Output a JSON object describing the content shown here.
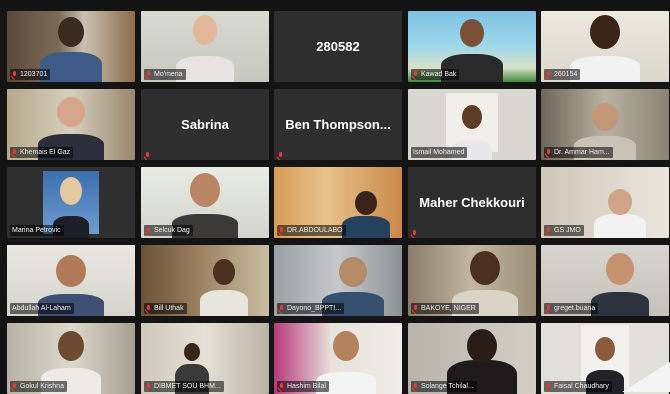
{
  "participants": [
    {
      "label": "1203701"
    },
    {
      "label": "Mo'mena"
    },
    {
      "display_name": "280582"
    },
    {
      "label": "Kawad Bak"
    },
    {
      "label": "260154"
    },
    {
      "label": "Khemais El Gaz"
    },
    {
      "display_name": "Sabrina"
    },
    {
      "display_name": "Ben Thompson..."
    },
    {
      "label": "Ismail Mohamed"
    },
    {
      "label": "Dr. Ammar Ham..."
    },
    {
      "label": "Marina Petrovic"
    },
    {
      "label": "Selcuk Dag"
    },
    {
      "label": "DR.ABDOULABO"
    },
    {
      "display_name": "Maher Chekkouri"
    },
    {
      "label": "GS JMO"
    },
    {
      "label": "Abdullah Al-Laham"
    },
    {
      "label": "Bill Uthak"
    },
    {
      "label": "Dayono_BPPTI..."
    },
    {
      "label": "BAKOYE, NIGER"
    },
    {
      "label": "greget.buana"
    },
    {
      "label": "Gokul Krishna"
    },
    {
      "label": "DIBMET SOU BHM..."
    },
    {
      "label": "Hashim Bilal"
    },
    {
      "label": "Solange Tchilal..."
    },
    {
      "label": "Faisal Chaudhary"
    }
  ]
}
